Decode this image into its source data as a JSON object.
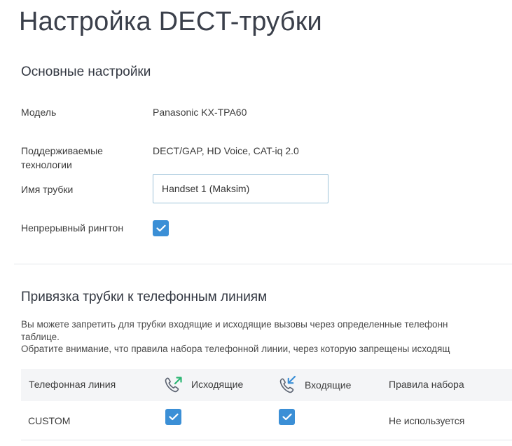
{
  "page": {
    "title": "Настройка DECT-трубки"
  },
  "basic": {
    "section_title": "Основные настройки",
    "model_label": "Модель",
    "model_value": "Panasonic KX-TPA60",
    "tech_label": "Поддерживаемые технологии",
    "tech_value": "DECT/GAP, HD Voice, CAT-iq 2.0",
    "name_label": "Имя трубки",
    "name_value": "Handset 1 (Maksim)",
    "ringtone_label": "Непрерывный рингтон",
    "ringtone_checked": true
  },
  "binding": {
    "section_title": "Привязка трубки к телефонным линиям",
    "description_lines": [
      "Вы можете запретить для трубки входящие и исходящие вызовы через определенные телефонн",
      "таблице.",
      "Обратите внимание, что правила набора телефонной линии, через которую запрещены исходящ"
    ],
    "columns": {
      "line": "Телефонная линия",
      "outgoing": "Исходящие",
      "incoming": "Входящие",
      "dial_rules": "Правила набора"
    },
    "rows": [
      {
        "line": "CUSTOM",
        "outgoing": true,
        "incoming": true,
        "dial_rules": "Не используется"
      }
    ]
  },
  "colors": {
    "checkbox": "#3b8fd6",
    "outgoing_arrow": "#2bb673",
    "incoming_arrow": "#3b8fd6"
  },
  "icons": {
    "outgoing": "phone-outgoing-icon",
    "incoming": "phone-incoming-icon",
    "check": "check-icon"
  }
}
